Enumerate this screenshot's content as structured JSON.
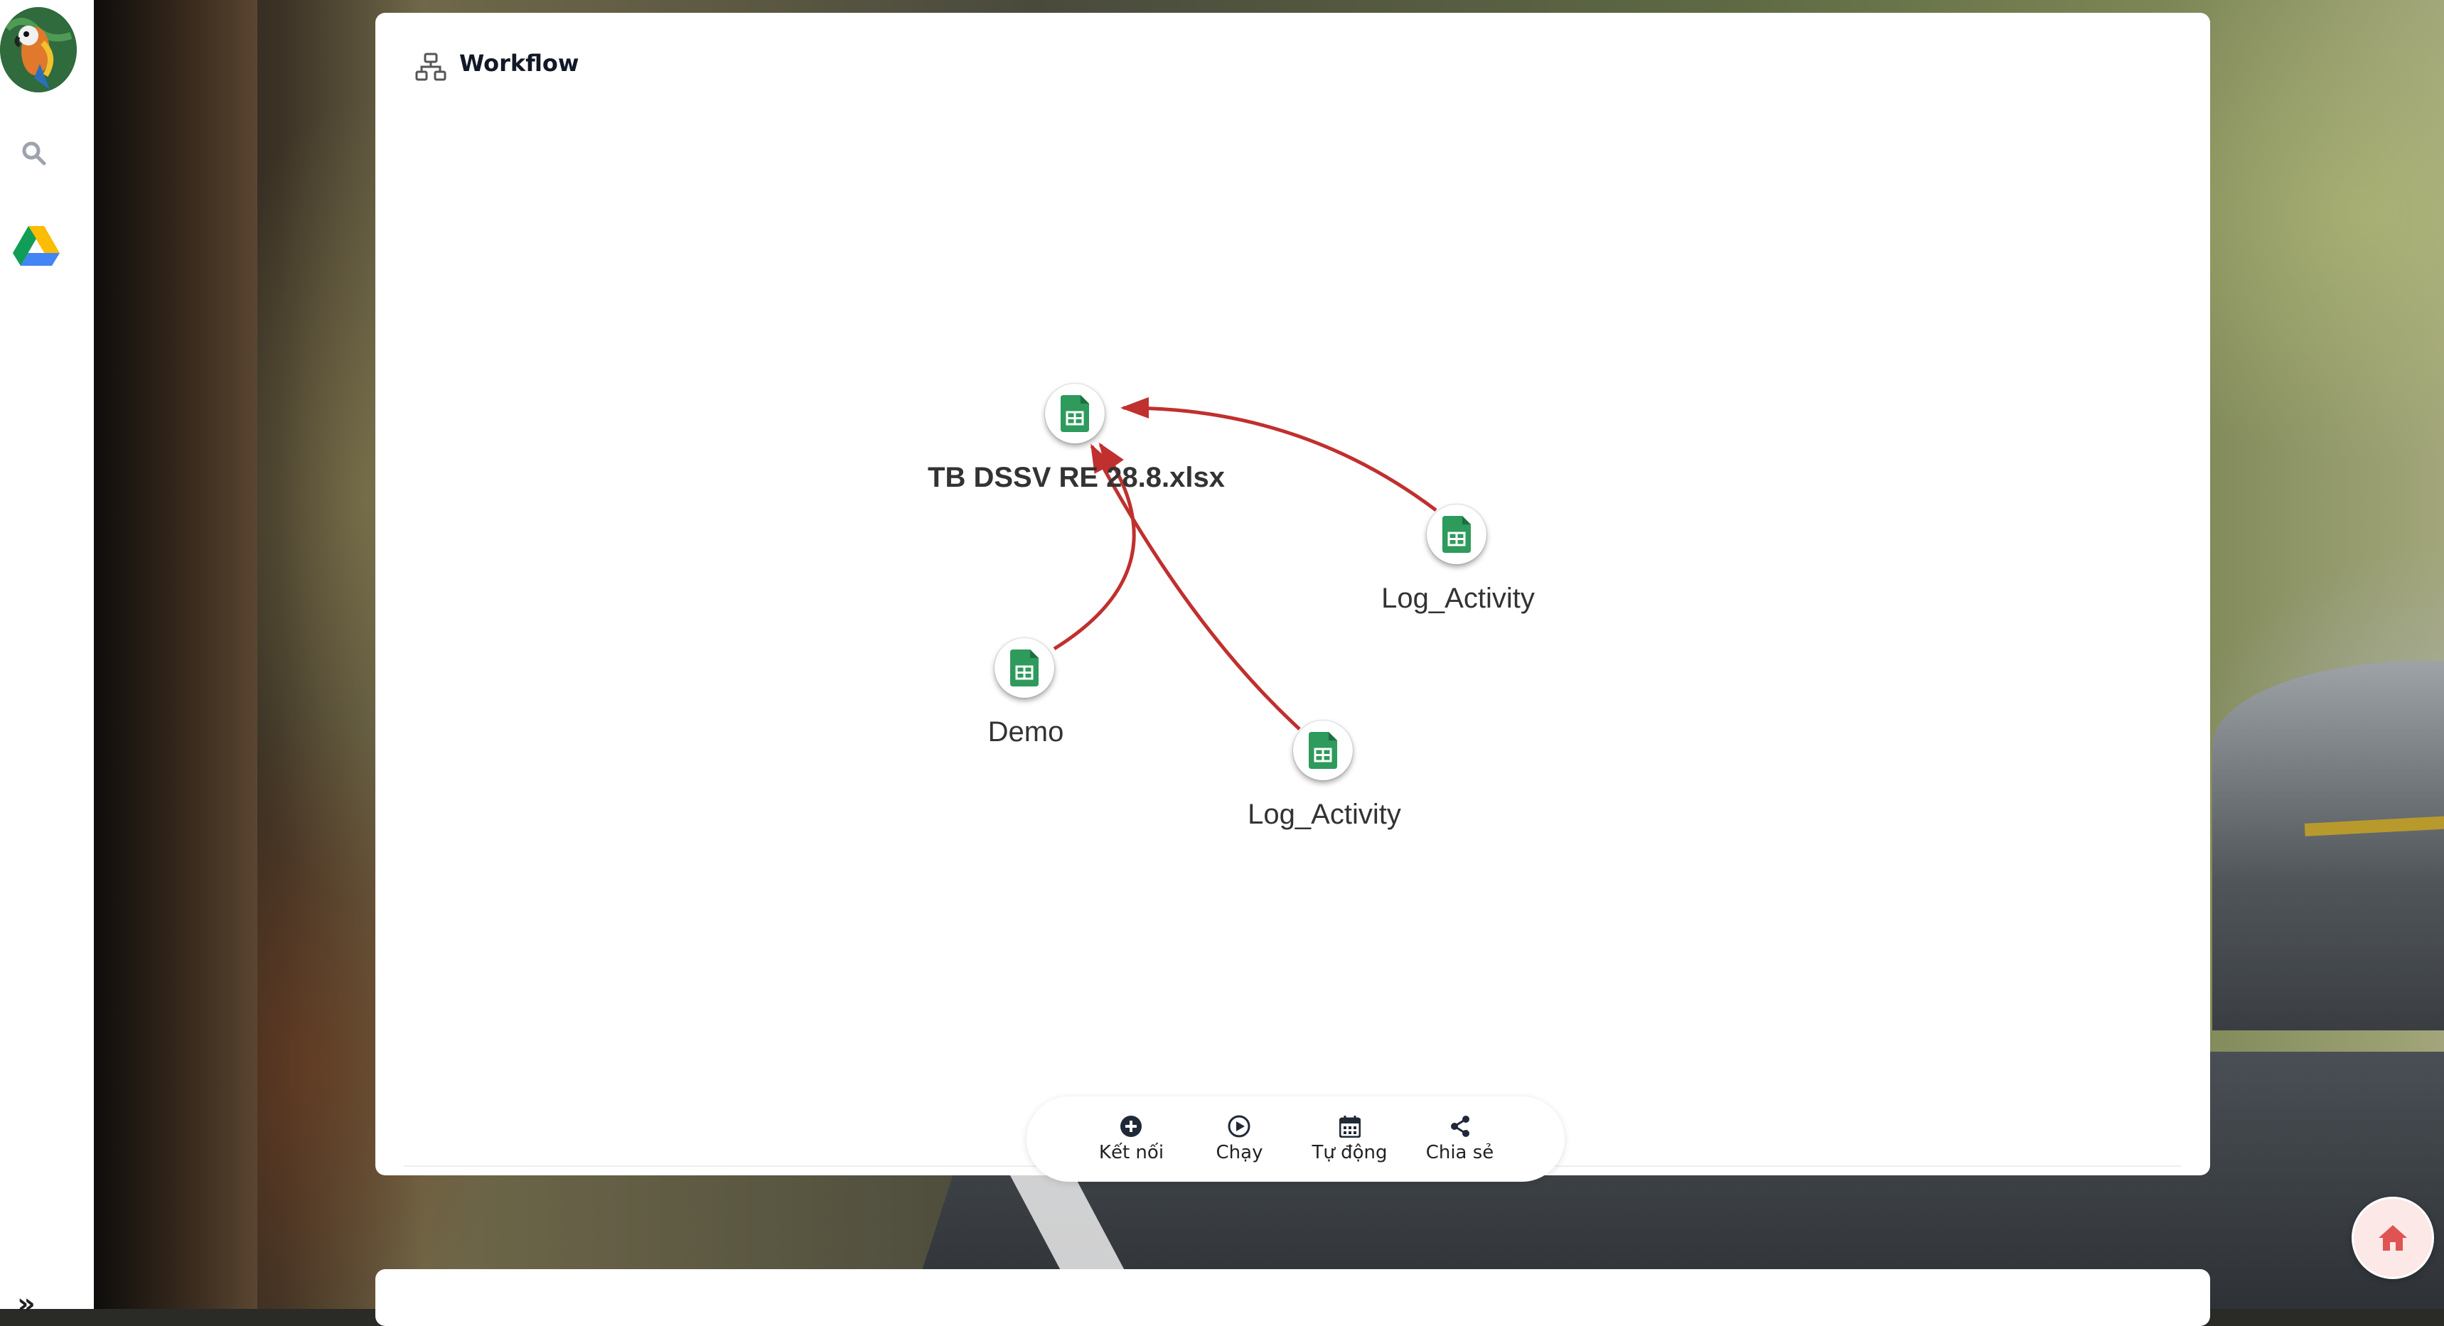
{
  "workflow": {
    "title": "Workflow",
    "nodes": [
      {
        "label": "TB DSSV RE 28.8.xlsx",
        "type": "google-sheets"
      },
      {
        "label": "Log_Activity",
        "type": "google-sheets"
      },
      {
        "label": "Demo",
        "type": "google-sheets"
      },
      {
        "label": "Log_Activity",
        "type": "google-sheets"
      }
    ],
    "edge_color": "#c0302e"
  },
  "toolbar": {
    "connect_label": "Kết nối",
    "run_label": "Chạy",
    "auto_label": "Tự động",
    "share_label": "Chia sẻ"
  },
  "sidebar": {
    "items": [
      {
        "icon": "avatar"
      },
      {
        "icon": "search-icon"
      },
      {
        "icon": "google-drive-icon"
      },
      {
        "icon": "expand-chevrons-icon"
      }
    ]
  },
  "colors": {
    "sheets_green": "#2e8b57",
    "home_accent": "#e05353"
  }
}
